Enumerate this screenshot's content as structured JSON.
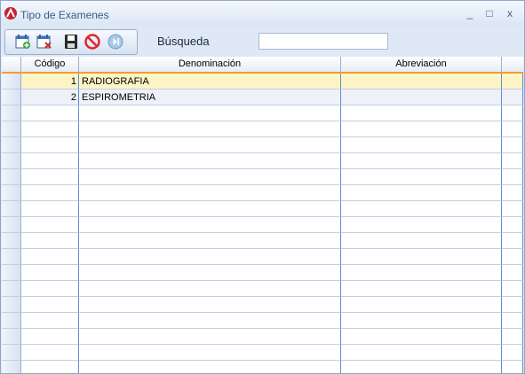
{
  "window": {
    "title": "Tipo de Examenes",
    "minimize_glyph": "_",
    "maximize_glyph": "□",
    "close_glyph": "x"
  },
  "toolbar": {
    "buttons": [
      "new-record-icon",
      "delete-record-icon",
      "save-icon",
      "cancel-icon",
      "next-icon"
    ],
    "search_label": "Búsqueda",
    "search_value": ""
  },
  "grid": {
    "columns": [
      "Código",
      "Denominación",
      "Abreviación"
    ],
    "rows": [
      {
        "codigo": "1",
        "denominacion": "RADIOGRAFIA",
        "abreviacion": ""
      },
      {
        "codigo": "2",
        "denominacion": "ESPIROMETRIA",
        "abreviacion": ""
      }
    ],
    "selected_row": 0
  },
  "colors": {
    "accent_orange": "#f39c33",
    "selection": "#fdf4c6",
    "grid_line": "#5f8fd4"
  }
}
